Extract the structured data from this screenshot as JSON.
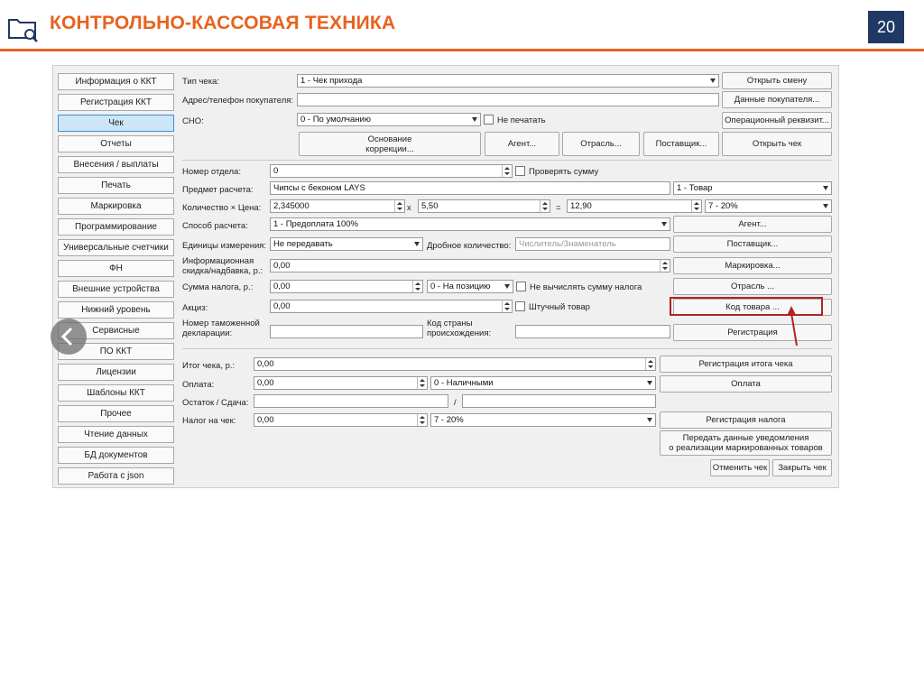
{
  "slide": {
    "title": "КОНТРОЛЬНО-КАССОВАЯ ТЕХНИКА",
    "page_number": "20",
    "accent_color": "#E8621D",
    "page_num_bg": "#1F3864",
    "icon": "folder-search-icon"
  },
  "sidebar": {
    "items": [
      {
        "label": "Информация о ККТ"
      },
      {
        "label": "Регистрация ККТ"
      },
      {
        "label": "Чек",
        "active": true
      },
      {
        "label": "Отчеты"
      },
      {
        "label": "Внесения / выплаты"
      },
      {
        "label": "Печать"
      },
      {
        "label": "Маркировка"
      },
      {
        "label": "Программирование"
      },
      {
        "label": "Универсальные счетчики"
      },
      {
        "label": "ФН"
      },
      {
        "label": "Внешние устройства"
      },
      {
        "label": "Нижний уровень"
      },
      {
        "label": "Сервисные"
      },
      {
        "label": "ПО ККТ"
      },
      {
        "label": "Лицензии"
      },
      {
        "label": "Шаблоны ККТ"
      },
      {
        "label": "Прочее"
      },
      {
        "label": "Чтение данных"
      },
      {
        "label": "БД документов"
      },
      {
        "label": "Работа с json"
      }
    ]
  },
  "header_form": {
    "receipt_type_label": "Тип чека:",
    "receipt_type_value": "1 - Чек прихода",
    "open_shift_button": "Открыть смену",
    "buyer_contact_label": "Адрес/телефон покупателя:",
    "buyer_contact_value": "",
    "buyer_data_button": "Данные покупателя...",
    "tax_system_label": "СНО:",
    "tax_system_value": "0 - По умолчанию",
    "no_print_label": "Не печатать",
    "operational_attr_button": "Операционный реквизит...",
    "correction_basis_button_line1": "Основание",
    "correction_basis_button_line2": "коррекции...",
    "agent_button": "Агент...",
    "industry_button": "Отрасль...",
    "supplier_button": "Поставщик...",
    "open_receipt_button": "Открыть чек"
  },
  "item_form": {
    "department_label": "Номер отдела:",
    "department_value": "0",
    "check_sum_label": "Проверять сумму",
    "subject_label": "Предмет расчета:",
    "subject_value": "Чипсы с беконом LAYS",
    "subject_type_value": "1 - Товар",
    "qty_price_label": "Количество × Цена:",
    "quantity_value": "2,345000",
    "times_sign": "x",
    "price_value": "5,50",
    "equals_sign": "=",
    "total_value": "12,90",
    "vat_value": "7 - 20%",
    "payment_method_label": "Способ расчета:",
    "payment_method_value": "1 - Предоплата 100%",
    "agent_button": "Агент...",
    "units_label": "Единицы измерения:",
    "units_value": "Не передавать",
    "fraction_label": "Дробное количество:",
    "fraction_placeholder": "Числитель/Знаменатель",
    "supplier_button": "Поставщик...",
    "info_discount_label_line1": "Информационная",
    "info_discount_label_line2": "скидка/надбавка, р.:",
    "info_discount_value": "0,00",
    "marking_button": "Маркировка...",
    "tax_sum_label": "Сумма налога, р.:",
    "tax_sum_value": "0,00",
    "tax_mode_value": "0 - На позицию",
    "no_calc_tax_label": "Не вычислять сумму налога",
    "industry_button": "Отрасль ...",
    "excise_label": "Акциз:",
    "excise_value": "0,00",
    "piece_goods_label": "Штучный товар",
    "product_code_button": "Код товара ...",
    "customs_label_line1": "Номер таможенной",
    "customs_label_line2": "декларации:",
    "customs_value": "",
    "country_label_line1": "Код страны",
    "country_label_line2": "происхождения:",
    "country_value": "",
    "register_button": "Регистрация"
  },
  "totals_form": {
    "total_label": "Итог чека, р.:",
    "total_value": "0,00",
    "register_total_button": "Регистрация итога чека",
    "payment_label": "Оплата:",
    "payment_value": "0,00",
    "payment_type_value": "0 - Наличными",
    "payment_button": "Оплата",
    "change_label": "Остаток / Сдача:",
    "remainder_value": "",
    "slash": "/",
    "change_value": "",
    "receipt_tax_label": "Налог на чек:",
    "receipt_tax_value": "0,00",
    "receipt_tax_rate_value": "7 - 20%",
    "register_tax_button": "Регистрация налога",
    "notify_button_line1": "Передать данные уведомления",
    "notify_button_line2": "о реализации маркированных товаров",
    "cancel_receipt_button": "Отменить чек",
    "close_receipt_button": "Закрыть чек"
  },
  "annotation": {
    "highlight_color": "#B22222"
  }
}
